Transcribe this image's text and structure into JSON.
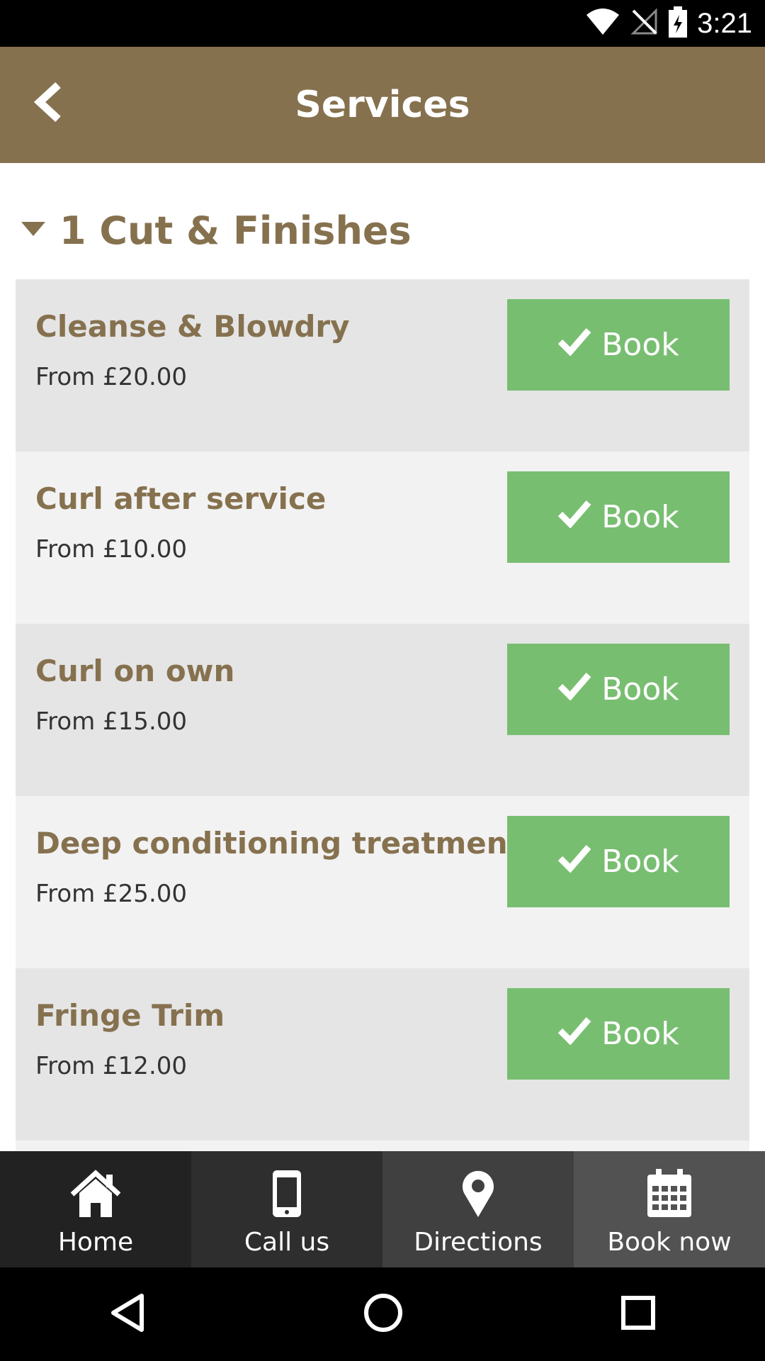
{
  "status_bar": {
    "time": "3:21",
    "icons": [
      "wifi-icon",
      "no-signal-icon",
      "battery-charging-icon"
    ]
  },
  "app_bar": {
    "title": "Services",
    "back_icon": "chevron-left-icon",
    "color": "#86714f"
  },
  "section": {
    "title": "1 Cut & Finishes",
    "expanded_icon": "caret-down-icon"
  },
  "services": [
    {
      "name": "Cleanse & Blowdry",
      "price": "From £20.00",
      "button": "Book"
    },
    {
      "name": "Curl after service",
      "price": "From £10.00",
      "button": "Book"
    },
    {
      "name": "Curl on own",
      "price": "From £15.00",
      "button": "Book"
    },
    {
      "name": "Deep conditioning treatment",
      "price": "From £25.00",
      "button": "Book"
    },
    {
      "name": "Fringe Trim",
      "price": "From £12.00",
      "button": "Book"
    }
  ],
  "book_button_color": "#78be71",
  "bottom_nav": [
    {
      "label": "Home",
      "icon": "home-icon",
      "bg": "#222222"
    },
    {
      "label": "Call us",
      "icon": "phone-icon",
      "bg": "#2e2e2e"
    },
    {
      "label": "Directions",
      "icon": "map-pin-icon",
      "bg": "#404040"
    },
    {
      "label": "Book now",
      "icon": "calendar-icon",
      "bg": "#525252"
    }
  ],
  "system_nav": [
    "back-triangle-icon",
    "home-circle-icon",
    "recents-square-icon"
  ]
}
